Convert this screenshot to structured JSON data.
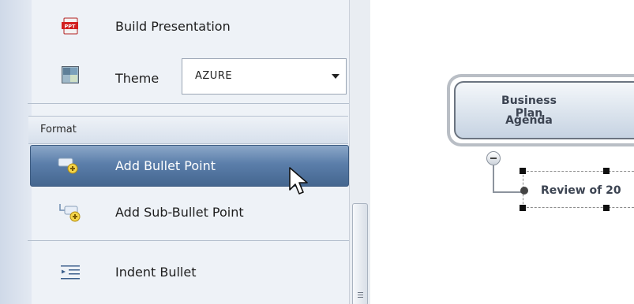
{
  "panel": {
    "build_presentation": {
      "label": "Build Presentation",
      "icon": "ppt-icon"
    },
    "theme": {
      "label": "Theme",
      "value": "AZURE"
    },
    "format_header": "Format",
    "items": [
      {
        "label": "Add Bullet Point",
        "icon": "add-bullet-icon",
        "highlighted": true
      },
      {
        "label": "Add Sub-Bullet Point",
        "icon": "add-sub-bullet-icon"
      },
      {
        "label": "Indent Bullet",
        "icon": "indent-icon"
      }
    ]
  },
  "canvas": {
    "main_node": {
      "line1": "Business Plan",
      "line2": "Agenda"
    },
    "child_node": {
      "text": "Review of 20"
    }
  },
  "colors": {
    "highlight": "#5b7eaa",
    "panel_bg": "#eef2f7",
    "node_fill": "#c6d3e2"
  }
}
